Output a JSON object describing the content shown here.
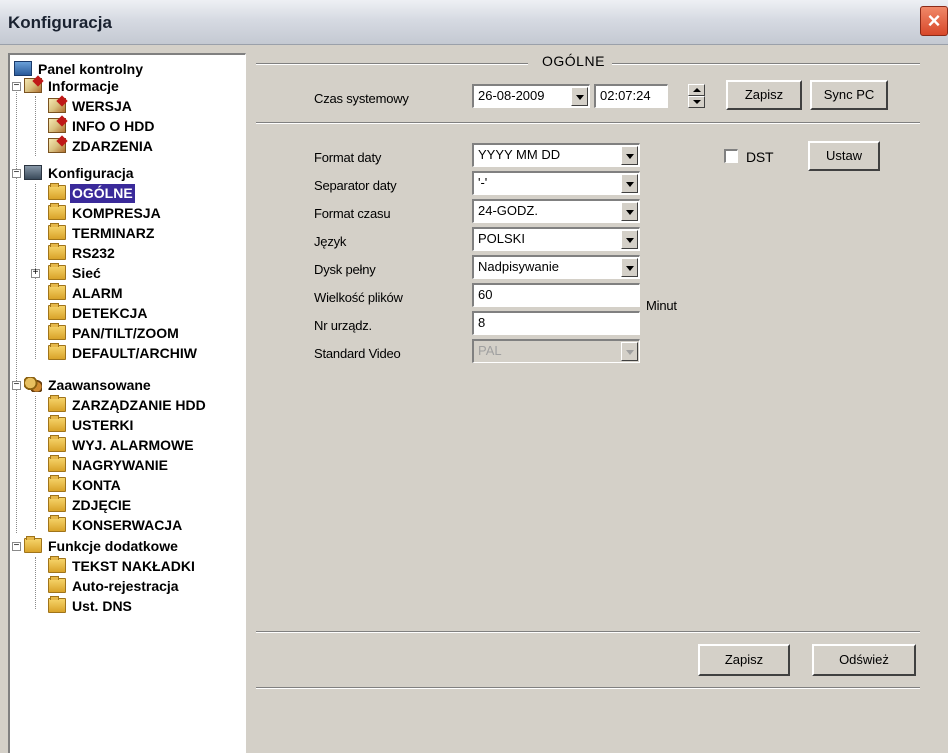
{
  "window": {
    "title": "Konfiguracja",
    "close_glyph": "×"
  },
  "tree": {
    "root": "Panel kontrolny",
    "informacje": {
      "label": "Informacje",
      "items": [
        "WERSJA",
        "INFO O HDD",
        "ZDARZENIA"
      ]
    },
    "konfiguracja": {
      "label": "Konfiguracja",
      "items": [
        "OGÓLNE",
        "KOMPRESJA",
        "TERMINARZ",
        "RS232",
        "Sieć",
        "ALARM",
        "DETEKCJA",
        "PAN/TILT/ZOOM",
        "DEFAULT/ARCHIW"
      ],
      "selected": "OGÓLNE"
    },
    "zaawansowane": {
      "label": "Zaawansowane",
      "items": [
        "ZARZĄDZANIE HDD",
        "USTERKI",
        "WYJ. ALARMOWE",
        "NAGRYWANIE",
        "KONTA",
        "ZDJĘCIE",
        "KONSERWACJA"
      ]
    },
    "funkcje": {
      "label": "Funkcje dodatkowe",
      "items": [
        "TEKST NAKŁADKI",
        "Auto-rejestracja",
        "Ust. DNS"
      ]
    },
    "icons": {
      "root": "monitor-icon",
      "info": "notes-icon",
      "config": "tools-icon",
      "advanced": "gears-icon",
      "item": "folder-icon"
    }
  },
  "section": {
    "title": "OGÓLNE"
  },
  "system_time": {
    "label": "Czas systemowy",
    "date": "26-08-2009",
    "time": "02:07:24",
    "save_label": "Zapisz",
    "sync_label": "Sync PC"
  },
  "form": {
    "date_format": {
      "label": "Format daty",
      "value": "YYYY MM DD"
    },
    "date_separator": {
      "label": "Separator daty",
      "value": "'-'"
    },
    "time_format": {
      "label": "Format czasu",
      "value": "24-GODZ."
    },
    "language": {
      "label": "Język",
      "value": "POLSKI"
    },
    "disk_full": {
      "label": "Dysk pełny",
      "value": "Nadpisywanie"
    },
    "file_size": {
      "label": "Wielkość plików",
      "value": "60",
      "unit": "Minut"
    },
    "device_no": {
      "label": "Nr urządz.",
      "value": "8"
    },
    "video_standard": {
      "label": "Standard Video",
      "value": "PAL"
    },
    "dst": {
      "label": "DST",
      "checked": false
    },
    "set_label": "Ustaw"
  },
  "footer": {
    "save_label": "Zapisz",
    "refresh_label": "Odśwież"
  },
  "colors": {
    "selection": "#3a2a9a",
    "panel": "#d4d0c8",
    "close": "#d8482a"
  }
}
